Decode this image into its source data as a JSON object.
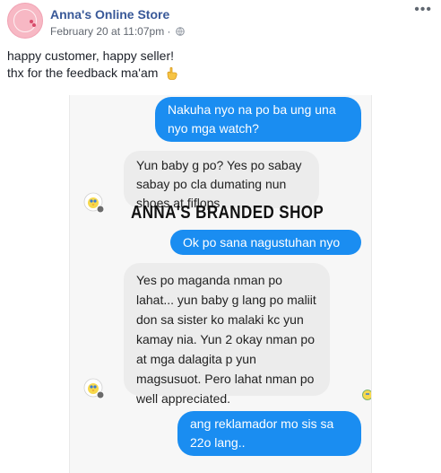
{
  "post": {
    "page_name": "Anna's Online Store",
    "date": "February 20 at 11:07pm",
    "separator": "·",
    "caption_line1": "happy customer, happy seller!",
    "caption_line2": "thx for the feedback ma'am"
  },
  "photo": {
    "watermark": "ANNA'S BRANDED SHOP",
    "messages": [
      {
        "direction": "outgoing",
        "text": "Nakuha nyo na po ba ung una nyo mga watch?"
      },
      {
        "direction": "incoming",
        "text": "Yun baby g po? Yes po sabay sabay po cla dumating nun shoes at fiflops"
      },
      {
        "direction": "outgoing",
        "text": "Ok po sana nagustuhan nyo"
      },
      {
        "direction": "incoming",
        "text": "Yes po maganda nman po lahat... yun baby g lang po maliit don sa sister ko malaki kc yun kamay nia. Yun 2 okay nman po at mga dalagita p yun magsusuot.  Pero lahat nman po well appreciated."
      },
      {
        "direction": "outgoing",
        "text": "ang reklamador mo sis sa 22o lang.."
      }
    ]
  },
  "icons": {
    "more": "more-options-icon",
    "globe": "globe-icon",
    "hand": "pointing-hand-icon",
    "avatar": "tweety-avatar-icon"
  },
  "colors": {
    "link": "#385898",
    "outgoing_bubble": "#1a8df1",
    "incoming_bubble": "#ececec"
  }
}
